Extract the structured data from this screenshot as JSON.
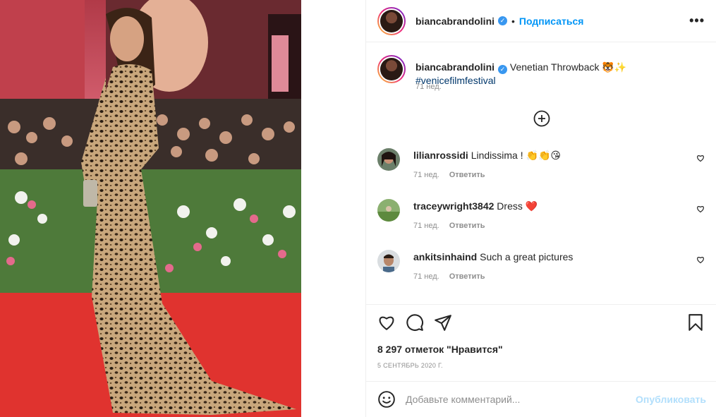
{
  "post": {
    "username": "biancabrandolini",
    "follow_label": "Подписаться",
    "separator": "•",
    "more_label": "•••"
  },
  "caption": {
    "username": "biancabrandolini",
    "text": "Venetian Throwback 🐯✨ ",
    "hashtag": "#venicefilmfestival",
    "time": "71 нед."
  },
  "comments": [
    {
      "username": "lilianrossidi",
      "text": "Lindissima ! 👏👏😘",
      "time": "71 нед.",
      "reply": "Ответить"
    },
    {
      "username": "traceywright3842",
      "text": "Dress ❤️",
      "time": "71 нед.",
      "reply": "Ответить"
    },
    {
      "username": "ankitsinhaind",
      "text": "Such a great pictures",
      "time": "71 нед.",
      "reply": "Ответить"
    }
  ],
  "likes_label": "8 297 отметок \"Нравится\"",
  "date_label": "5 СЕНТЯБРЬ 2020 Г.",
  "comment_box": {
    "placeholder": "Добавьте комментарий...",
    "publish_label": "Опубликовать"
  },
  "colors": {
    "link_blue": "#0095f6",
    "hashtag_blue": "#00376b",
    "muted_gray": "#8e8e8e",
    "publish_disabled": "#b2dffc",
    "carpet_red": "#e0332f"
  },
  "icons": [
    "verified-badge-icon",
    "more-options-icon",
    "add-circle-icon",
    "heart-icon",
    "comment-icon",
    "share-icon",
    "bookmark-icon",
    "emoji-icon"
  ]
}
